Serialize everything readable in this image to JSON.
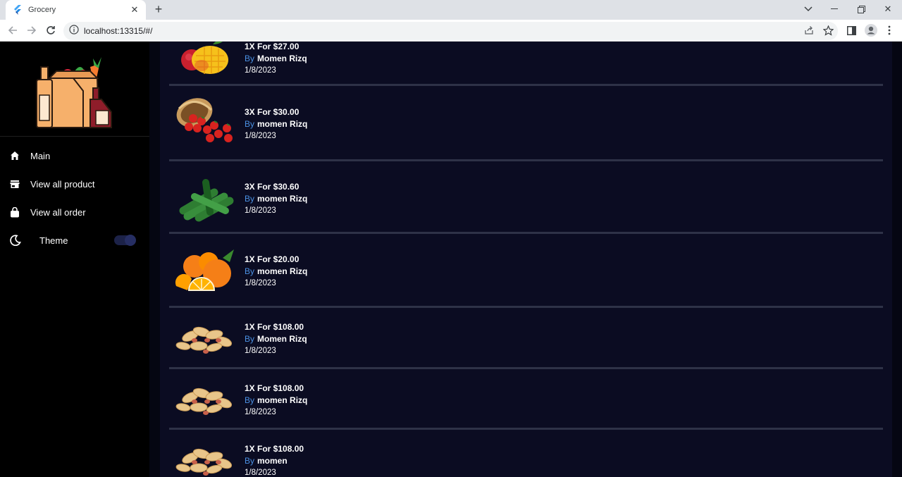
{
  "browser": {
    "tab_title": "Grocery",
    "url": "localhost:13315/#/"
  },
  "sidebar": {
    "items": [
      {
        "label": "Main",
        "icon": "home-icon"
      },
      {
        "label": "View all product",
        "icon": "store-icon"
      },
      {
        "label": "View all order",
        "icon": "shopping-bag-icon"
      }
    ],
    "theme": {
      "label": "Theme",
      "icon": "moon-icon",
      "enabled": true
    }
  },
  "products": [
    {
      "qty": "1X For $27.00",
      "by": "By",
      "author": "Momen Rizq",
      "date": "1/8/2023",
      "image": "mango-apple"
    },
    {
      "qty": "3X For $30.00",
      "by": "By",
      "author": "momen Rizq",
      "date": "1/8/2023",
      "image": "tomatoes-basket"
    },
    {
      "qty": "3X For $30.60",
      "by": "By",
      "author": "momen Rizq",
      "date": "1/8/2023",
      "image": "cucumbers"
    },
    {
      "qty": "1X For $20.00",
      "by": "By",
      "author": "momen Rizq",
      "date": "1/8/2023",
      "image": "oranges"
    },
    {
      "qty": "1X For $108.00",
      "by": "By",
      "author": "Momen Rizq",
      "date": "1/8/2023",
      "image": "peanuts"
    },
    {
      "qty": "1X For $108.00",
      "by": "By",
      "author": "momen Rizq",
      "date": "1/8/2023",
      "image": "peanuts"
    },
    {
      "qty": "1X For $108.00",
      "by": "By",
      "author": "momen",
      "date": "1/8/2023",
      "image": "peanuts"
    }
  ],
  "colors": {
    "background": "#0b0c22",
    "sidebar": "#000000",
    "accent": "#4a90e2",
    "separator": "#2e3247"
  }
}
